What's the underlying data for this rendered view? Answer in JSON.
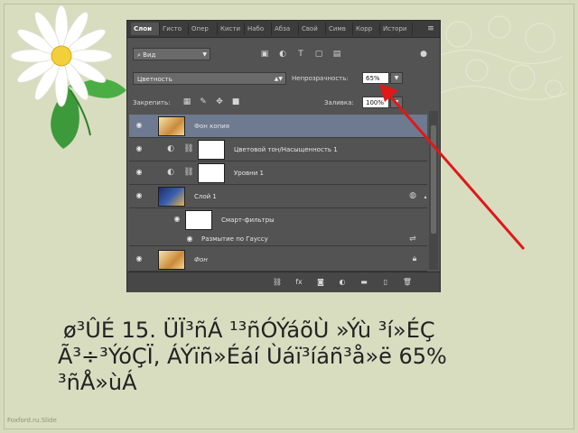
{
  "panel": {
    "tabs": [
      "Слои",
      "Гисто",
      "Опер",
      "Кисти",
      "Набо",
      "Абза",
      "Свой",
      "Симв",
      "Корр",
      "Истори"
    ],
    "active_tab": 0,
    "filter_label": "Вид",
    "blend_mode": "Цветность",
    "opacity_label": "Непрозрачность:",
    "opacity_value": "65%",
    "lock_label": "Закрепить:",
    "fill_label": "Заливка:",
    "fill_value": "100%",
    "layers": [
      {
        "name": "Фон копия",
        "type": "image",
        "selected": true
      },
      {
        "name": "Цветовой тон/Насыщенность 1",
        "type": "adjustment"
      },
      {
        "name": "Уровни 1",
        "type": "adjustment"
      },
      {
        "name": "Слой 1",
        "type": "smart"
      },
      {
        "name": "Смарт-фильтры",
        "type": "smart-filters"
      },
      {
        "name": "Размытие по Гауссу",
        "type": "filter"
      },
      {
        "name": "Фон",
        "type": "background"
      }
    ]
  },
  "caption": {
    "line1": "ø³ÛÉ 15. ÜÏ³ñÁ ¹³ñÓÝáõÙ »Ýù ³í»ÉÇ",
    "line2": "Ã³÷³ÝóÇÏ, ÁÝïñ»Éáí Ùáï³íáñ³å»ë 65%",
    "line3": "³ñÅ»ùÁ"
  },
  "footer": "Foxford.ru.Slide",
  "colors": {
    "arrow": "#e01818",
    "panel_bg": "#535353",
    "selected_row": "#6d7a90",
    "slide_bg": "#d6dbbd"
  }
}
